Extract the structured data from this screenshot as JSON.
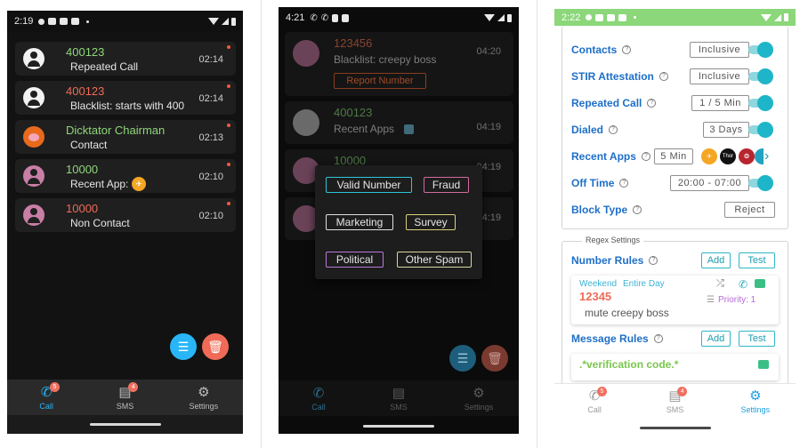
{
  "phone1": {
    "status": {
      "time": "2:19"
    },
    "calls": [
      {
        "number": "400123",
        "detail": "Repeated Call",
        "time": "02:14",
        "color": "green",
        "avatar": "person-white-icon"
      },
      {
        "number": "400123",
        "detail": "Blacklist: starts with 400",
        "time": "02:14",
        "color": "red",
        "avatar": "person-white-icon"
      },
      {
        "number": "Dicktator Chairman",
        "detail": "Contact",
        "time": "02:13",
        "color": "green",
        "avatar": "pig-avatar-icon"
      },
      {
        "number": "10000",
        "detail": "Recent App:",
        "time": "02:10",
        "color": "green",
        "avatar": "person-pink-icon"
      },
      {
        "number": "10000",
        "detail": "Non Contact",
        "time": "02:10",
        "color": "red",
        "avatar": "person-pink-icon"
      }
    ],
    "fab_filter_color": "#29b6f6",
    "fab_delete_color": "#ef6b57",
    "nav": [
      {
        "label": "Call",
        "badge": "5",
        "icon": "phone-icon",
        "active": true
      },
      {
        "label": "SMS",
        "badge": "4",
        "icon": "message-icon",
        "active": false
      },
      {
        "label": "Settings",
        "badge": "",
        "icon": "gear-icon",
        "active": false
      }
    ]
  },
  "phone2": {
    "status": {
      "time": "4:21"
    },
    "calls": [
      {
        "number": "123456",
        "detail": "Blacklist: creepy boss",
        "time": "04:20",
        "action": "Report Number"
      },
      {
        "number": "400123",
        "detail": "Recent Apps",
        "time": "04:19"
      },
      {
        "number": "10000",
        "detail": "",
        "time": "04:19"
      },
      {
        "number": "",
        "detail": "",
        "time": "04:19"
      }
    ],
    "report_chips": [
      {
        "label": "Valid Number",
        "color": "#2fc7d9"
      },
      {
        "label": "Fraud",
        "color": "#d56aa0"
      },
      {
        "label": "Marketing",
        "color": "#e0e0e0"
      },
      {
        "label": "Survey",
        "color": "#d9d27a"
      },
      {
        "label": "Political",
        "color": "#b77ad9"
      },
      {
        "label": "Other Spam",
        "color": "#d9d8a0"
      }
    ],
    "nav": [
      {
        "label": "Call",
        "badge": "",
        "icon": "phone-icon"
      },
      {
        "label": "SMS",
        "badge": "",
        "icon": "message-icon"
      },
      {
        "label": "Settings",
        "badge": "",
        "icon": "gear-icon"
      }
    ]
  },
  "phone3": {
    "status": {
      "time": "2:22"
    },
    "settings": [
      {
        "label": "Contacts",
        "value": "Inclusive",
        "toggle": true
      },
      {
        "label": "STIR Attestation",
        "value": "Inclusive",
        "toggle": true
      },
      {
        "label": "Repeated Call",
        "value": "1 / 5 Min",
        "toggle": true
      },
      {
        "label": "Dialed",
        "value": "3 Days",
        "toggle": true
      },
      {
        "label": "Recent Apps",
        "value": "5 Min",
        "toggle": false
      },
      {
        "label": "Off Time",
        "value": "20:00 - 07:00",
        "toggle": true
      },
      {
        "label": "Block Type",
        "value": "Reject",
        "toggle": false
      }
    ],
    "recent_app_icon_text": "Thor",
    "regex": {
      "legend": "Regex Settings",
      "number_rules_label": "Number Rules",
      "message_rules_label": "Message Rules",
      "add_label": "Add",
      "test_label": "Test",
      "rule": {
        "schedule_a": "Weekend",
        "schedule_b": "Entire Day",
        "pattern": "12345",
        "description": "mute creepy boss",
        "priority": "Priority: 1"
      },
      "message_rule_pattern": ".*verification code.*"
    },
    "nav": [
      {
        "label": "Call",
        "badge": "5",
        "icon": "phone-icon",
        "active": false
      },
      {
        "label": "SMS",
        "badge": "4",
        "icon": "message-icon",
        "active": false
      },
      {
        "label": "Settings",
        "badge": "",
        "icon": "gear-icon",
        "active": true
      }
    ]
  }
}
